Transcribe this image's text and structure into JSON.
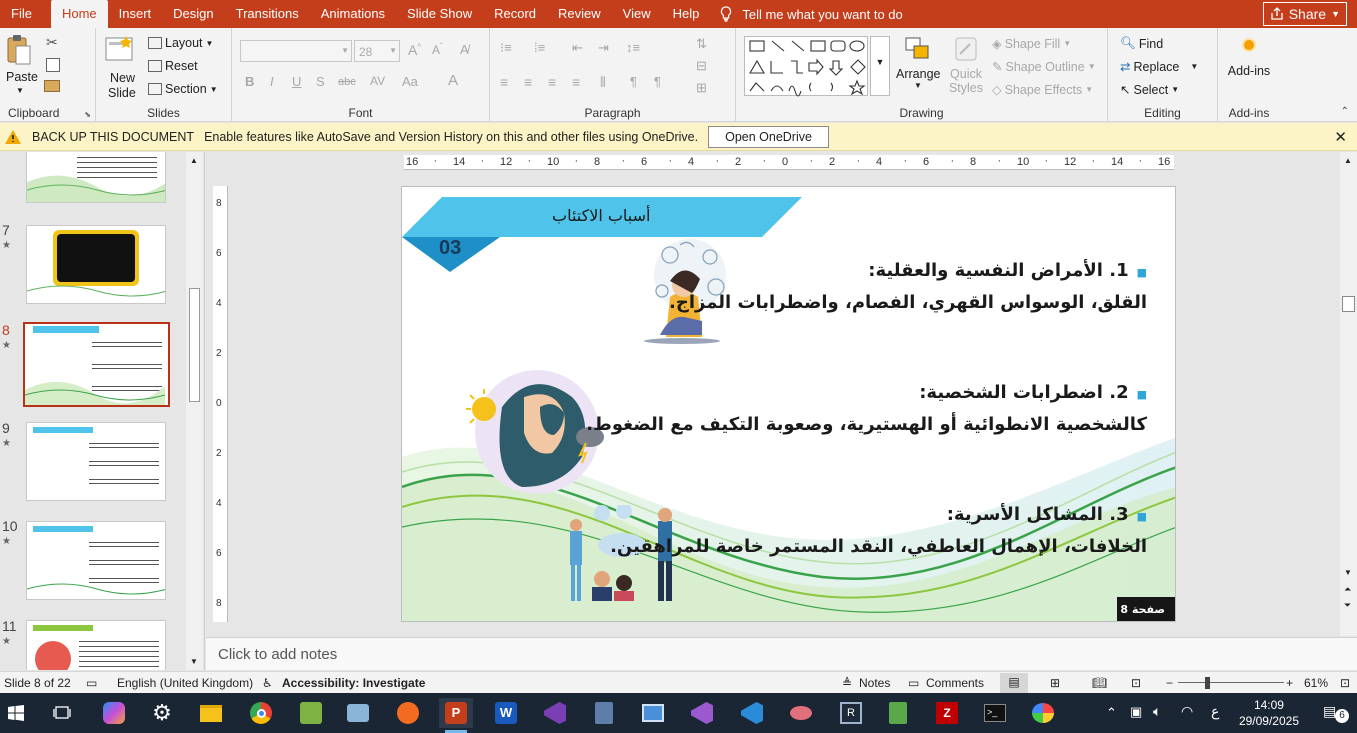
{
  "ribbon_tabs": [
    "File",
    "Home",
    "Insert",
    "Design",
    "Transitions",
    "Animations",
    "Slide Show",
    "Record",
    "Review",
    "View",
    "Help"
  ],
  "tell_me": "Tell me what you want to do",
  "share_label": "Share",
  "clipboard": {
    "paste": "Paste",
    "label": "Clipboard"
  },
  "slides_group": {
    "new_slide_line1": "New",
    "new_slide_line2": "Slide",
    "layout": "Layout",
    "reset": "Reset",
    "section": "Section",
    "label": "Slides"
  },
  "font_group": {
    "size": "28",
    "label": "Font"
  },
  "paragraph_group": {
    "label": "Paragraph"
  },
  "drawing_group": {
    "arrange": "Arrange",
    "quick_styles_1": "Quick",
    "quick_styles_2": "Styles",
    "shape_fill": "Shape Fill",
    "shape_outline": "Shape Outline",
    "shape_effects": "Shape Effects",
    "label": "Drawing"
  },
  "editing_group": {
    "find": "Find",
    "replace": "Replace",
    "select": "Select",
    "label": "Editing"
  },
  "addins_group": {
    "addins": "Add-ins",
    "label": "Add-ins"
  },
  "notification": {
    "title": "BACK UP THIS DOCUMENT",
    "message": "Enable features like AutoSave and Version History on this and other files using OneDrive.",
    "button": "Open OneDrive"
  },
  "thumbnails": [
    {
      "num": "7"
    },
    {
      "num": "8"
    },
    {
      "num": "9"
    },
    {
      "num": "10"
    },
    {
      "num": "11"
    }
  ],
  "ruler": {
    "h": [
      "16",
      "14",
      "12",
      "10",
      "8",
      "6",
      "4",
      "2",
      "0",
      "2",
      "4",
      "6",
      "8",
      "10",
      "12",
      "14",
      "16"
    ],
    "v": [
      "8",
      "6",
      "4",
      "2",
      "0",
      "2",
      "4",
      "6",
      "8"
    ]
  },
  "slide": {
    "header": "أسباب الاكتئاب",
    "number": "03",
    "item1_title": "1. الأمراض النفسية والعقلية:",
    "item1_body": "القلق، الوسواس القهري، الفصام، واضطرابات المزاج.",
    "item2_title": "2. اضطرابات الشخصية:",
    "item2_body": "كالشخصية الانطوائية أو الهستيرية، وصعوبة التكيف مع الضغوط.",
    "item3_title": "3. المشاكل الأسرية:",
    "item3_body": "الخلافات، الإهمال العاطفي، النقد المستمر خاصة للمراهقين.",
    "page_label": "صفحة 8"
  },
  "notes_placeholder": "Click to add notes",
  "status": {
    "slide": "Slide 8 of 22",
    "language": "English (United Kingdom)",
    "accessibility": "Accessibility: Investigate",
    "notes": "Notes",
    "comments": "Comments",
    "zoom": "61%"
  },
  "taskbar": {
    "time": "14:09",
    "date": "29/09/2025",
    "lang": "ع",
    "notif": "6"
  },
  "colors": {
    "accent": "#c43e1c",
    "slide_blue": "#4fc3ea",
    "slide_dark_blue": "#2a9fd6",
    "wave_green": "#3aa34a"
  }
}
